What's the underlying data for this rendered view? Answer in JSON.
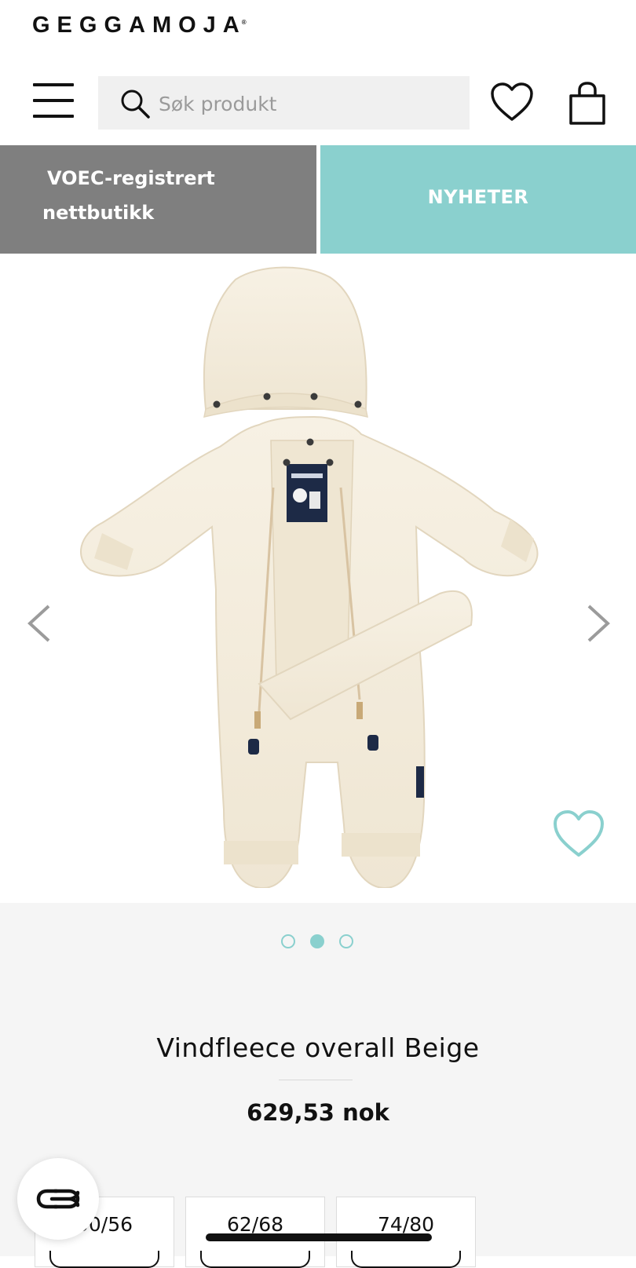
{
  "header": {
    "logo": "GEGGAMOJA",
    "logo_mark": "®",
    "search_placeholder": "Søk produkt"
  },
  "banners": {
    "left_line1": "VOEC-registrert",
    "left_line2": "nettbutikk",
    "right_label": "NYHETER"
  },
  "gallery": {
    "active_slide": 2,
    "slide_count": 3
  },
  "product": {
    "title": "Vindfleece overall Beige",
    "price": "629,53 nok",
    "sizes": [
      "50/56",
      "62/68",
      "74/80"
    ]
  },
  "icons": {
    "menu": "menu-icon",
    "search": "search-icon",
    "wishlist": "heart-icon",
    "cart": "shopping-bag-icon",
    "prev": "chevron-left-icon",
    "next": "chevron-right-icon",
    "chat": "chat-icon"
  },
  "colors": {
    "accent": "#8ad0ce",
    "banner_gray": "#7f7f7f",
    "product_beige": "#f5eedf"
  }
}
